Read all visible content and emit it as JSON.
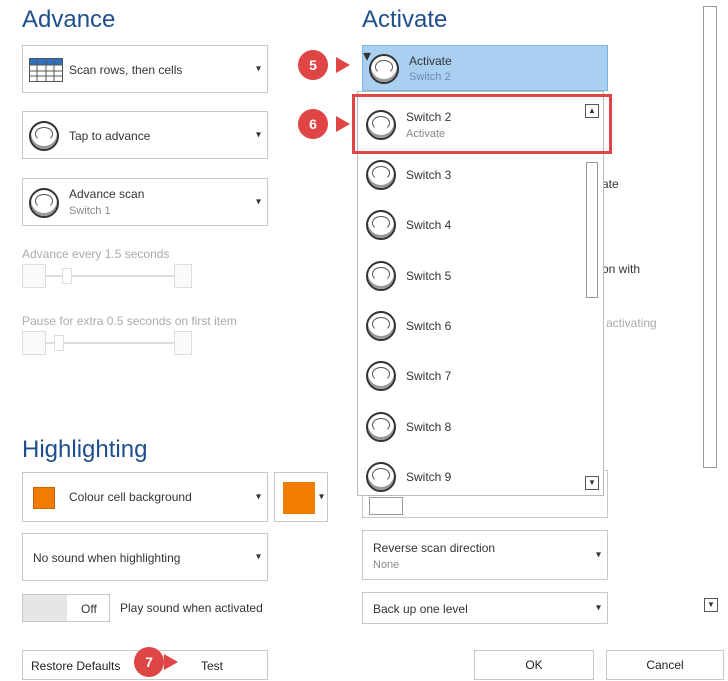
{
  "advance": {
    "title": "Advance",
    "scan_mode": "Scan rows, then cells",
    "tap_mode": "Tap to advance",
    "advance_scan": {
      "label": "Advance scan",
      "value": "Switch 1"
    },
    "advance_every": "Advance every 1.5 seconds",
    "pause_first": "Pause for extra 0.5 seconds on first item"
  },
  "highlighting": {
    "title": "Highlighting",
    "colour_option": "Colour cell background",
    "colour_value": "#f07d00",
    "sound_option": "No sound when highlighting",
    "toggle_state": "Off",
    "toggle_label": "Play sound when activated"
  },
  "activate": {
    "title": "Activate",
    "selected": {
      "label": "Activate",
      "value": "Switch 2"
    },
    "highlighted_item": {
      "label": "Switch 2",
      "value": "Activate"
    },
    "list_items": [
      "Switch 3",
      "Switch 4",
      "Switch 5",
      "Switch 6",
      "Switch 7",
      "Switch 8",
      "Switch 9"
    ],
    "partial_text": {
      "t1": "ate",
      "t2": "on with",
      "t3": "activating"
    },
    "reverse_scan": {
      "label": "Reverse scan direction",
      "value": "None"
    },
    "back_up": "Back up one level"
  },
  "footer": {
    "restore": "Restore Defaults",
    "test": "Test",
    "ok": "OK",
    "cancel": "Cancel"
  },
  "annotations": {
    "b5": "5",
    "b6": "6",
    "b7": "7"
  }
}
